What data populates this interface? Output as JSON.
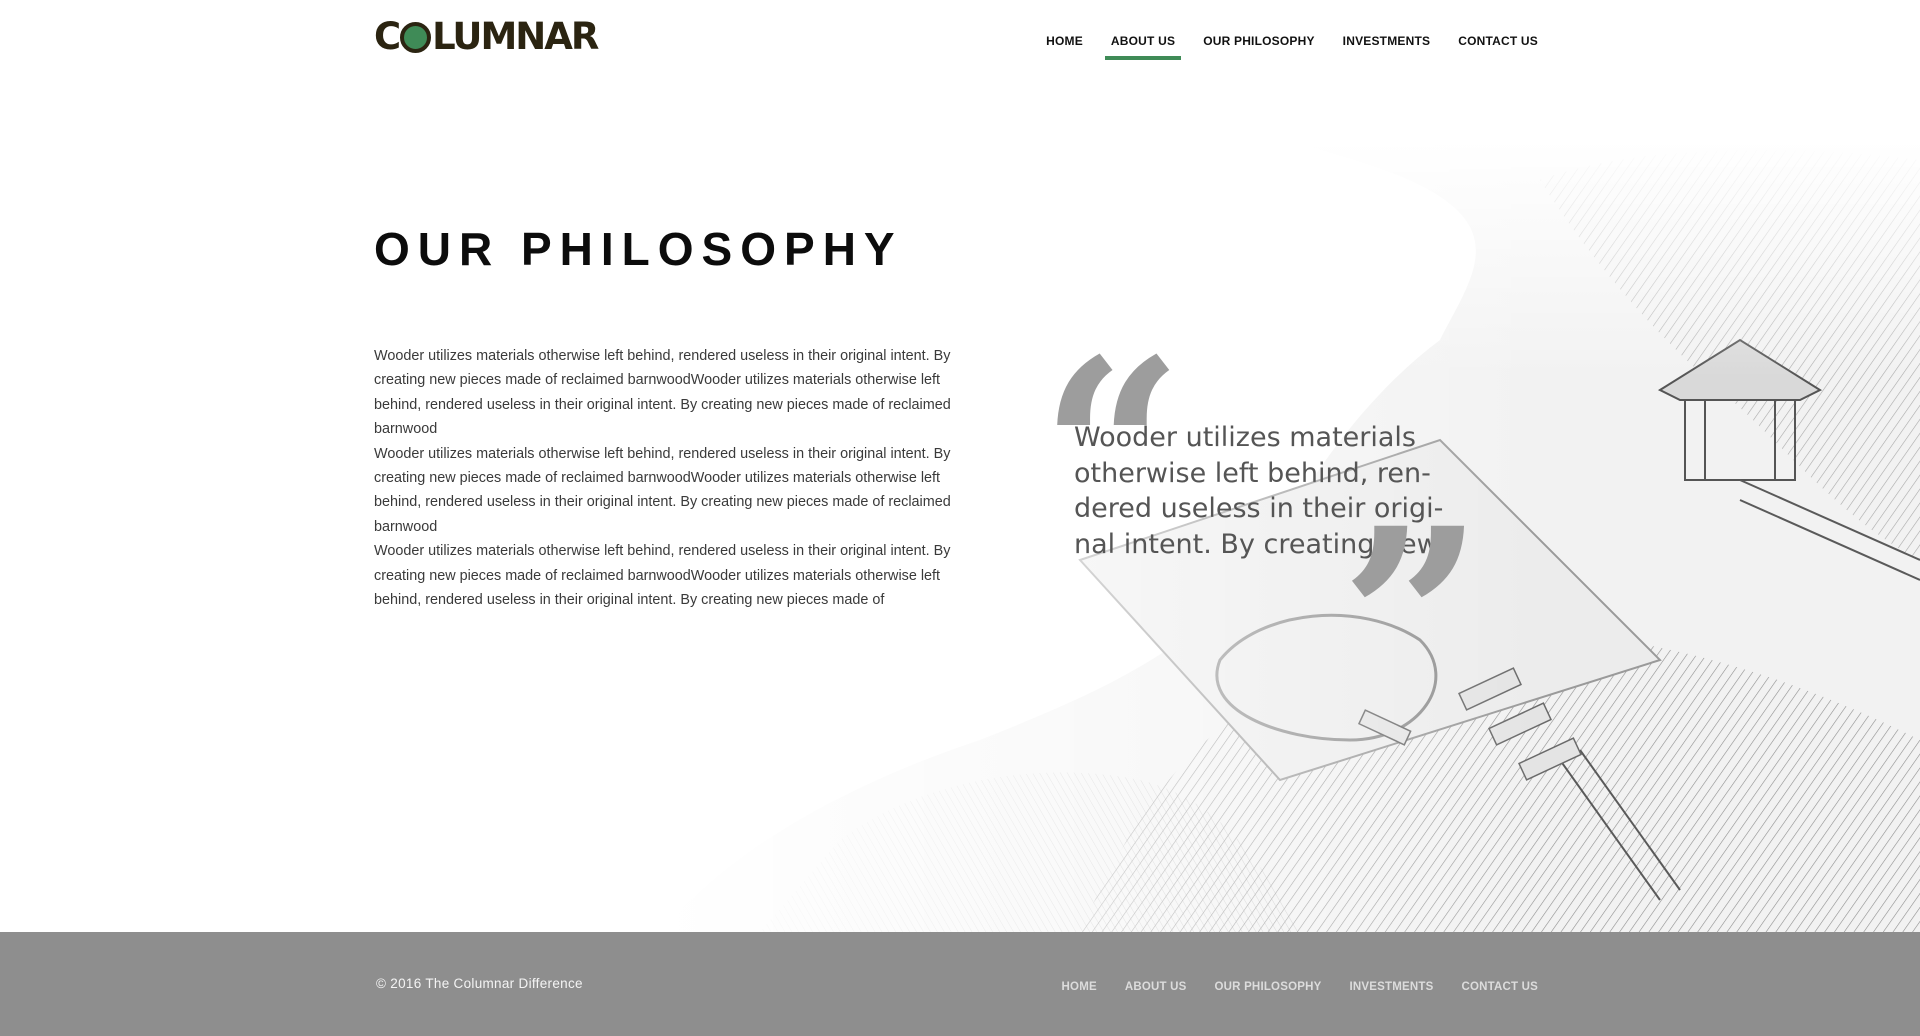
{
  "header": {
    "logo_text": "COLUMNAR",
    "logo_pre": "C",
    "logo_post": "LUMNAR",
    "nav": [
      {
        "label": "HOME"
      },
      {
        "label": "ABOUT US",
        "active": true
      },
      {
        "label": "OUR PHILOSOPHY"
      },
      {
        "label": "INVESTMENTS"
      },
      {
        "label": "CONTACT US"
      }
    ]
  },
  "main": {
    "title": "OUR PHILOSOPHY",
    "paragraphs": [
      "Wooder utilizes materials otherwise left behind, rendered useless in their original intent. By creating new pieces made of reclaimed barnwoodWooder utilizes materials otherwise left behind, rendered useless in their original intent. By creating new pieces made of reclaimed barnwood",
      "Wooder utilizes materials otherwise left behind, rendered useless in their original intent. By creating new pieces made of reclaimed barnwoodWooder utilizes materials otherwise left behind, rendered useless in their original intent. By creating new pieces made of reclaimed barnwood",
      "Wooder utilizes materials otherwise left behind, rendered useless in their original intent. By creating new pieces made of reclaimed barnwoodWooder utilizes materials otherwise left behind, rendered useless in their original intent. By creating new pieces made of"
    ],
    "quote": {
      "open_mark": "“",
      "text": "Wooder utilizes materials otherwise left behind, ren-dered useless in their origi-nal intent. By creating new",
      "close_mark": "”"
    }
  },
  "footer": {
    "copyright": "© 2016  The Columnar Difference",
    "nav": [
      {
        "label": "HOME"
      },
      {
        "label": "ABOUT US"
      },
      {
        "label": "OUR PHILOSOPHY"
      },
      {
        "label": "INVESTMENTS"
      },
      {
        "label": "CONTACT US"
      }
    ]
  },
  "colors": {
    "accent": "#3f8b57",
    "logo_dark": "#2b2411",
    "footer_bg": "#8e8e8e",
    "quote_mark": "#9d9d9d"
  }
}
